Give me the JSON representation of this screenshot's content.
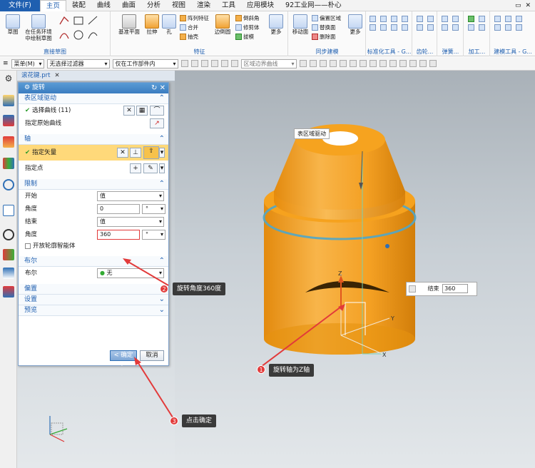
{
  "menubar": {
    "tabs": [
      "文件(F)",
      "主页",
      "装配",
      "曲线",
      "曲面",
      "分析",
      "视图",
      "渲染",
      "工具",
      "应用模块",
      "92工业网——朴心"
    ],
    "active": "主页"
  },
  "ribbon": {
    "sketch_label": "草图",
    "task_sketch_label": "在任务环境中绘制草图",
    "direct_sketch_group": "直接草图",
    "datum_plane_label": "基准平面",
    "extrude_label": "拉伸",
    "hole_label": "孔",
    "pattern_feature_label": "阵列特征",
    "unite_label": "合并",
    "shell_label": "抽壳",
    "edge_blend_label": "边倒圆",
    "chamfer_label": "倒斜角",
    "trim_body_label": "修剪体",
    "draft_label": "拔模",
    "more1_label": "更多",
    "feature_group": "特征",
    "move_face_label": "移动面",
    "offset_region_label": "偏置区域",
    "replace_face_label": "替换面",
    "delete_face_label": "删除面",
    "more2_label": "更多",
    "sync_group": "同步建模",
    "std_tools_group": "标准化工具 - G...",
    "gear_group": "齿轮...",
    "spring_group": "弹簧...",
    "machining_group": "加工...",
    "modeling_tools_group": "建模工具 - G..."
  },
  "toolbar2": {
    "menu_label": "菜单(M)",
    "filter_value": "无选择过滤器",
    "scope_value": "仅在工作部件内",
    "region_value": "区域边界曲线"
  },
  "file_tab": {
    "name": "滚花键.prt"
  },
  "dialog": {
    "title": "旋转",
    "sections": {
      "region_drive": "表区域驱动",
      "axis": "轴",
      "limits": "限制",
      "boolean": "布尔",
      "offset": "偏置",
      "settings": "设置",
      "preview": "预览"
    },
    "select_curve": "选择曲线 (11)",
    "specify_origin_curve": "指定原始曲线",
    "specify_vector": "指定矢量",
    "specify_point": "指定点",
    "start_label": "开始",
    "start_value": "值",
    "start_angle_label": "角度",
    "start_angle": "0",
    "end_label": "结束",
    "end_value": "值",
    "end_angle_label": "角度",
    "end_angle": "360",
    "angle_unit": "°",
    "open_profile_smart_volume": "开放轮廓智能体",
    "boolean_label": "布尔",
    "boolean_value": "无",
    "ok_label": "< 确定 >",
    "cancel_label": "取消"
  },
  "viewport": {
    "region_label": "表区域驱动",
    "end_field_label": "结束",
    "end_field_value": "360",
    "axis_z": "Z",
    "axis_y": "Y",
    "axis_x": "X"
  },
  "annotations": [
    {
      "num": "1",
      "text": "旋转轴为Z轴"
    },
    {
      "num": "2",
      "text": "旋转角度360度"
    },
    {
      "num": "3",
      "text": "点击确定"
    }
  ],
  "colors": {
    "accent": "#1f5fb0",
    "part_orange": "#f5a623",
    "callout_bg": "#3a3a3a",
    "badge_red": "#e23a3a",
    "highlight_row": "#ffd97a"
  }
}
